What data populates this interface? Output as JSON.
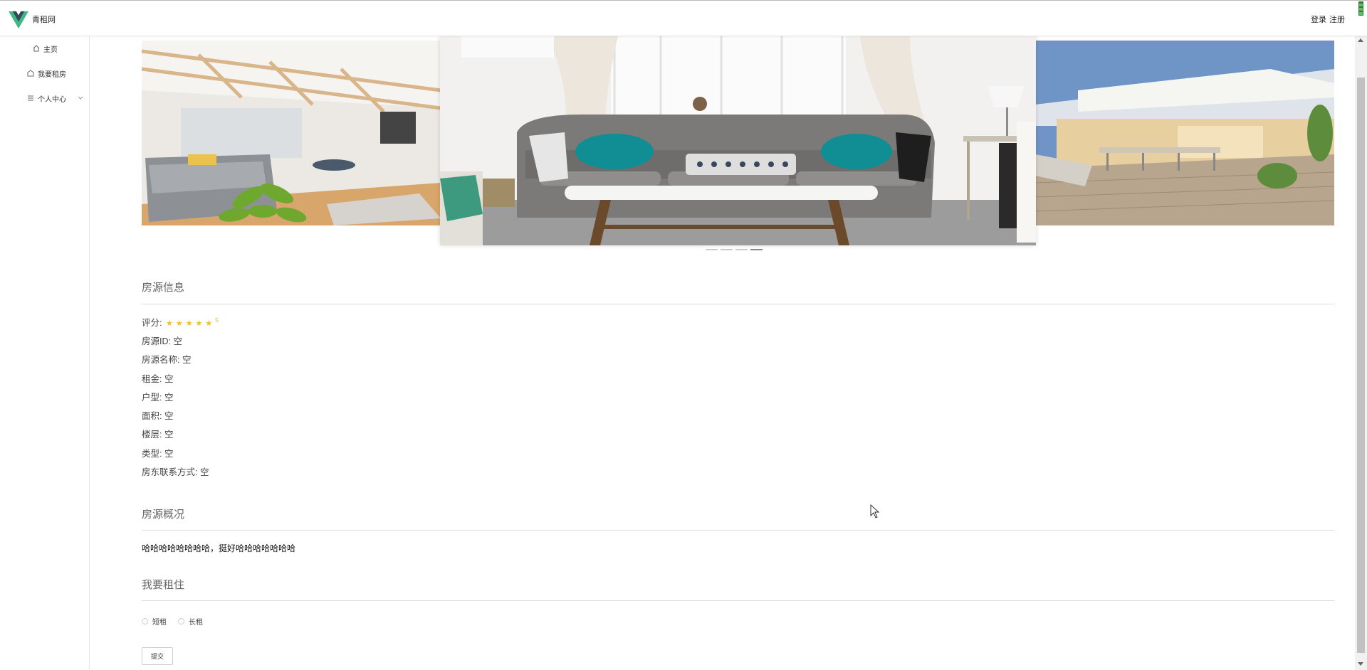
{
  "header": {
    "brand": "青租网",
    "login_label": "登录",
    "register_label": "注册"
  },
  "sidebar": {
    "items": [
      {
        "label": "主页",
        "icon": "home-icon"
      },
      {
        "label": "我要租房",
        "icon": "house-icon"
      },
      {
        "label": "个人中心",
        "icon": "menu-icon"
      }
    ]
  },
  "carousel": {
    "slide_count": 4,
    "active_index": 3
  },
  "house_info": {
    "title": "房源信息",
    "rating_label": "评分:",
    "rating_stars": "★★★★★",
    "rating_value": "5",
    "rows": [
      {
        "label": "房源ID:",
        "value": "空"
      },
      {
        "label": "房源名称:",
        "value": "空"
      },
      {
        "label": "租金:",
        "value": "空"
      },
      {
        "label": "户型:",
        "value": "空"
      },
      {
        "label": "面积:",
        "value": "空"
      },
      {
        "label": "楼层:",
        "value": "空"
      },
      {
        "label": "类型:",
        "value": "空"
      },
      {
        "label": "房东联系方式:",
        "value": "空"
      }
    ]
  },
  "overview": {
    "title": "房源概况",
    "text": "哈哈哈哈哈哈哈哈，挺好哈哈哈哈哈哈哈"
  },
  "rent": {
    "title": "我要租住",
    "options": [
      "短租",
      "长租"
    ],
    "submit_label": "提交"
  },
  "colors": {
    "star": "#f7ba2a",
    "logo_green": "#41b883",
    "logo_dark": "#35495e"
  }
}
